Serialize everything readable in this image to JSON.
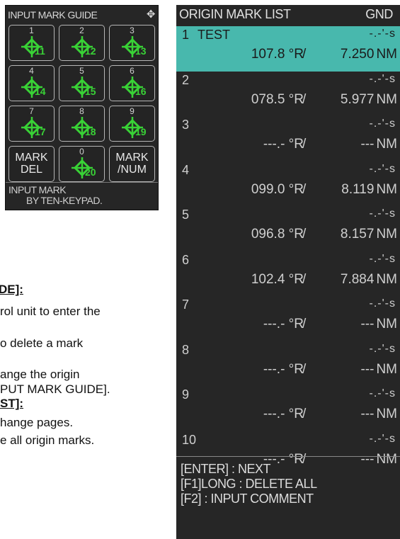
{
  "guide": {
    "title": "INPUT MARK GUIDE",
    "move_icon": "move-arrows-icon",
    "keys": [
      {
        "num": "1",
        "sub": "11"
      },
      {
        "num": "2",
        "sub": "12"
      },
      {
        "num": "3",
        "sub": "13"
      },
      {
        "num": "4",
        "sub": "14"
      },
      {
        "num": "5",
        "sub": "15"
      },
      {
        "num": "6",
        "sub": "16"
      },
      {
        "num": "7",
        "sub": "17"
      },
      {
        "num": "8",
        "sub": "18"
      },
      {
        "num": "9",
        "sub": "19"
      },
      {
        "num": "0",
        "sub": "20"
      }
    ],
    "mark_del": "MARK\nDEL",
    "mark_num": "MARK\n/NUM",
    "footer_line1": "INPUT MARK",
    "footer_line2": "BY TEN-KEYPAD.",
    "mark_color": "#39d236"
  },
  "doc_text": {
    "heading1": "DE]:",
    "line1": "rol unit to enter the",
    "line2": "o delete a mark",
    "line3": "ange the origin",
    "line4": "PUT MARK GUIDE].",
    "heading2": "ST]:",
    "line5": "hange pages.",
    "line6": "e all origin marks."
  },
  "list": {
    "title": "ORIGIN MARK LIST",
    "gnd_label": "GND",
    "selected_color": "#48b8ad",
    "rows": [
      {
        "idx": "1",
        "name": "TEST",
        "gnd": "-.-'-s",
        "bearing": "107.8 °R",
        "dist": "7.250",
        "unit": "NM"
      },
      {
        "idx": "2",
        "name": "",
        "gnd": "-.-'-s",
        "bearing": "078.5 °R",
        "dist": "5.977",
        "unit": "NM"
      },
      {
        "idx": "3",
        "name": "",
        "gnd": "-.-'-s",
        "bearing": "---.- °R",
        "dist": "---",
        "unit": "NM"
      },
      {
        "idx": "4",
        "name": "",
        "gnd": "-.-'-s",
        "bearing": "099.0 °R",
        "dist": "8.119",
        "unit": "NM"
      },
      {
        "idx": "5",
        "name": "",
        "gnd": "-.-'-s",
        "bearing": "096.8 °R",
        "dist": "8.157",
        "unit": "NM"
      },
      {
        "idx": "6",
        "name": "",
        "gnd": "-.-'-s",
        "bearing": "102.4 °R",
        "dist": "7.884",
        "unit": "NM"
      },
      {
        "idx": "7",
        "name": "",
        "gnd": "-.-'-s",
        "bearing": "---.- °R",
        "dist": "---",
        "unit": "NM"
      },
      {
        "idx": "8",
        "name": "",
        "gnd": "-.-'-s",
        "bearing": "---.- °R",
        "dist": "---",
        "unit": "NM"
      },
      {
        "idx": "9",
        "name": "",
        "gnd": "-.-'-s",
        "bearing": "---.- °R",
        "dist": "---",
        "unit": "NM"
      },
      {
        "idx": "10",
        "name": "",
        "gnd": "-.-'-s",
        "bearing": "---.- °R",
        "dist": "---",
        "unit": "NM"
      }
    ],
    "slash": "/",
    "footer": [
      "[ENTER] : NEXT",
      "[F1]LONG : DELETE ALL",
      "[F2] : INPUT COMMENT"
    ]
  }
}
